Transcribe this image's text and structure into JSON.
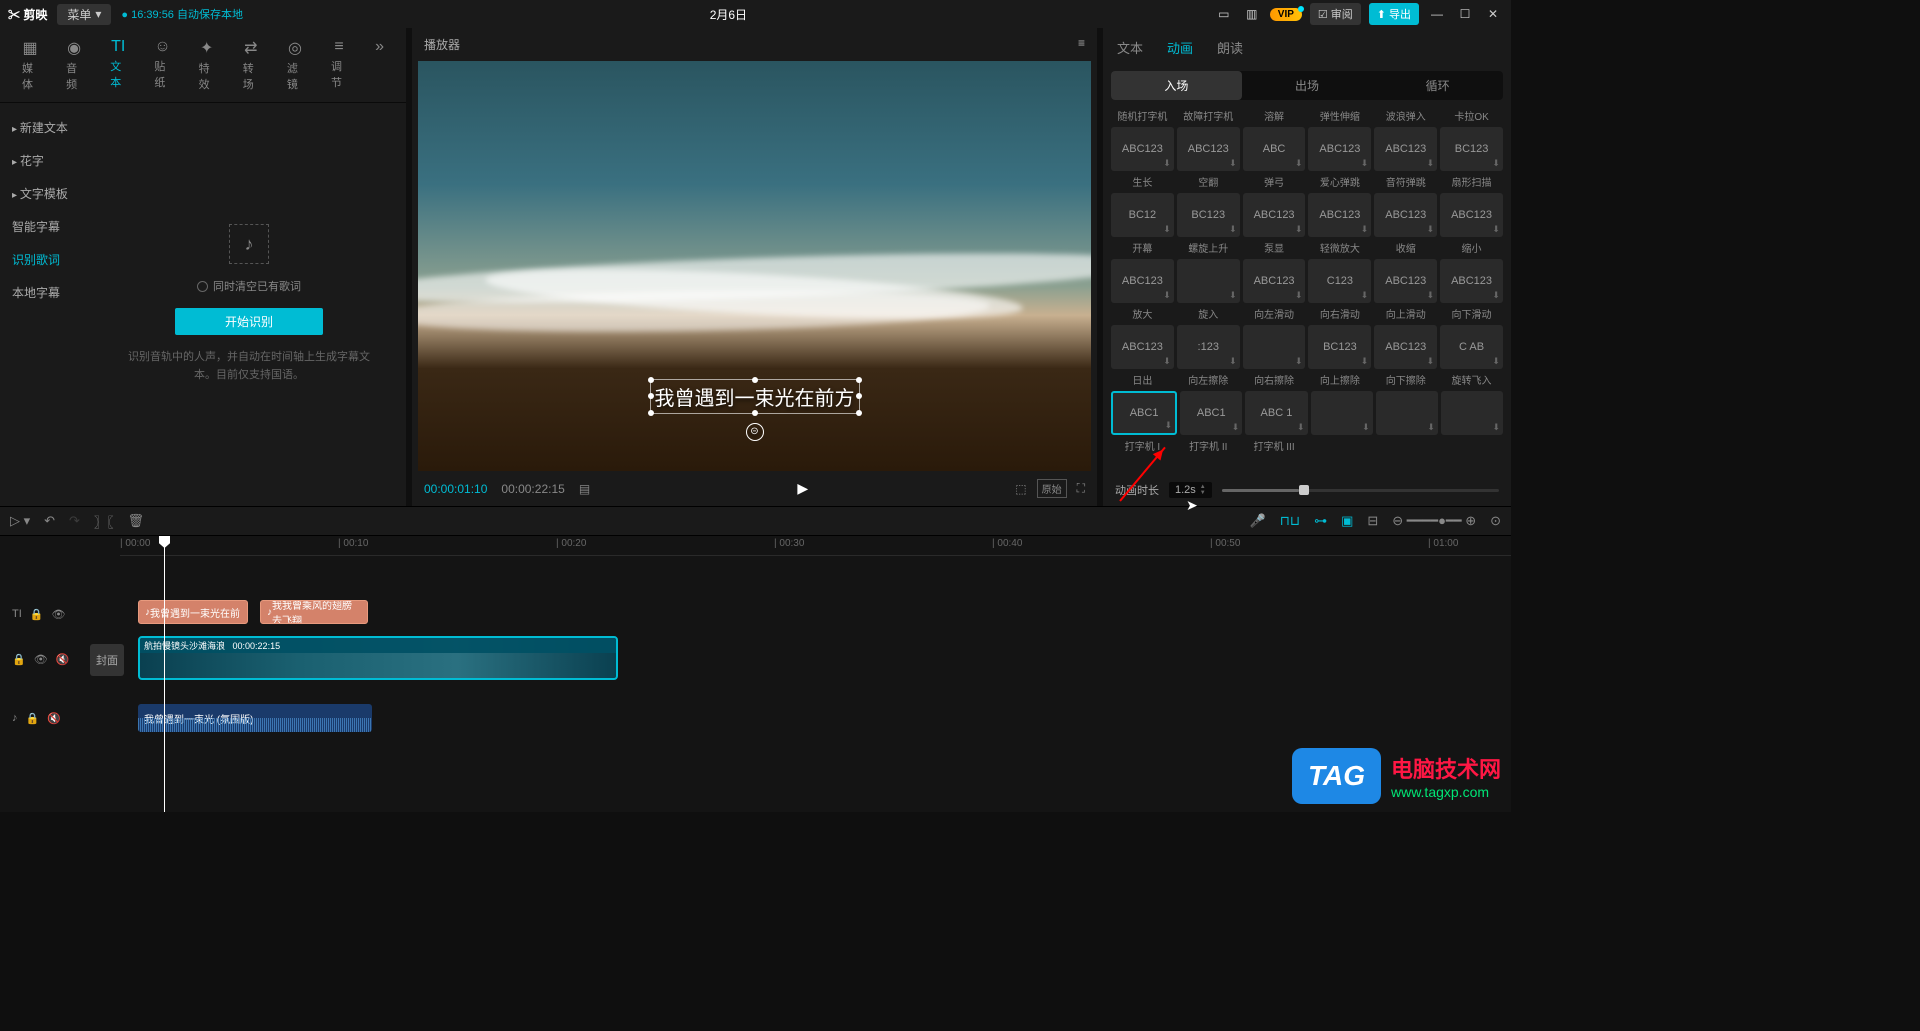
{
  "titlebar": {
    "logo": "剪映",
    "menu": "菜单",
    "save_status": "16:39:56 自动保存本地",
    "title": "2月6日",
    "review": "审阅",
    "export": "导出"
  },
  "tool_tabs": [
    {
      "icon": "▦",
      "label": "媒体"
    },
    {
      "icon": "◉",
      "label": "音频"
    },
    {
      "icon": "TI",
      "label": "文本"
    },
    {
      "icon": "☺",
      "label": "贴纸"
    },
    {
      "icon": "✦",
      "label": "特效"
    },
    {
      "icon": "⇄",
      "label": "转场"
    },
    {
      "icon": "◎",
      "label": "滤镜"
    },
    {
      "icon": "≡",
      "label": "调节"
    }
  ],
  "side_menu": {
    "new_text": "新建文本",
    "flower": "花字",
    "template": "文字模板",
    "smart": "智能字幕",
    "lyrics": "识别歌词",
    "local": "本地字幕"
  },
  "left": {
    "checkbox": "同时清空已有歌词",
    "start": "开始识别",
    "hint": "识别音轨中的人声，并自动在时间轴上生成字幕文本。目前仅支持国语。"
  },
  "player": {
    "header": "播放器",
    "subtitle": "我曾遇到一束光在前方",
    "time_cur": "00:00:01:10",
    "time_total": "00:00:22:15"
  },
  "right_tabs": {
    "text": "文本",
    "anim": "动画",
    "read": "朗读"
  },
  "sub_tabs": {
    "in": "入场",
    "out": "出场",
    "loop": "循环"
  },
  "anim_labels_r1": [
    "随机打字机",
    "故障打字机",
    "溶解",
    "弹性伸缩",
    "波浪弹入",
    "卡拉OK"
  ],
  "anim_cells_r1": [
    "ABC123",
    "ABC123",
    "ABC",
    "ABC123",
    "ABC123",
    "BC123"
  ],
  "anim_labels_r2": [
    "生长",
    "空翻",
    "弹弓",
    "爱心弹跳",
    "音符弹跳",
    "扇形扫描"
  ],
  "anim_cells_r2": [
    "BC12",
    "BC123",
    "ABC123",
    "ABC123",
    "ABC123",
    "ABC123"
  ],
  "anim_labels_r3": [
    "开幕",
    "螺旋上升",
    "泵显",
    "轻微放大",
    "收缩",
    "缩小"
  ],
  "anim_cells_r3": [
    "ABC123",
    "",
    "ABC123",
    "C123",
    "ABC123",
    "ABC123"
  ],
  "anim_labels_r4": [
    "放大",
    "旋入",
    "向左滑动",
    "向右滑动",
    "向上滑动",
    "向下滑动"
  ],
  "anim_cells_r4": [
    "ABC123",
    ":123",
    "",
    "BC123",
    "ABC123",
    "C AB"
  ],
  "anim_labels_r5": [
    "日出",
    "向左擦除",
    "向右擦除",
    "向上擦除",
    "向下擦除",
    "旋转飞入"
  ],
  "anim_cells_r5": [
    "ABC1",
    "ABC1",
    "ABC  1",
    "",
    "",
    ""
  ],
  "anim_labels_r6": [
    "打字机 I",
    "打字机 II",
    "打字机 III",
    "",
    "",
    ""
  ],
  "duration": {
    "label": "动画时长",
    "value": "1.2s"
  },
  "timeline": {
    "ticks": [
      "00:00",
      "00:10",
      "00:20",
      "00:30",
      "00:40",
      "00:50",
      "01:00"
    ],
    "cover": "封面",
    "text_clip1": "我曾遇到一束光在前",
    "text_clip2": "我我曾乘风的翅膀去飞翔",
    "video_name": "航拍慢镜头沙滩海浪",
    "video_dur": "00:00:22:15",
    "audio_name": "我曾遇到一束光 (氛围版)"
  },
  "watermark": {
    "tag": "TAG",
    "cn": "电脑技术网",
    "en": "www.tagxp.com"
  }
}
